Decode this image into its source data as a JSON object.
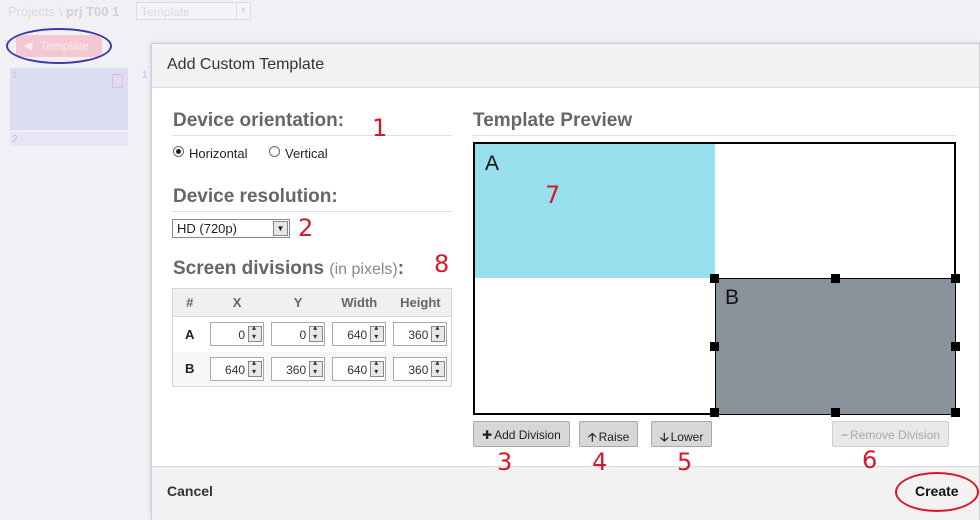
{
  "background": {
    "breadcrumb_prefix": "Projects \\",
    "breadcrumb_project": "prj T00 1",
    "select_value": "Template",
    "template_button": "Template",
    "card_numbers": [
      "1",
      "2",
      "1"
    ]
  },
  "dialog": {
    "title": "Add Custom Template",
    "orientation": {
      "title": "Device orientation:",
      "options": [
        {
          "label": "Horizontal",
          "checked": true
        },
        {
          "label": "Vertical",
          "checked": false
        }
      ]
    },
    "resolution": {
      "title": "Device resolution:",
      "selected": "HD (720p)"
    },
    "divisions": {
      "title": "Screen divisions",
      "subtitle": "(in pixels)",
      "colon": ":",
      "columns": [
        "#",
        "X",
        "Y",
        "Width",
        "Height"
      ],
      "rows": [
        {
          "id": "A",
          "x": "0",
          "y": "0",
          "width": "640",
          "height": "360"
        },
        {
          "id": "B",
          "x": "640",
          "y": "360",
          "width": "640",
          "height": "360"
        }
      ]
    },
    "preview": {
      "title": "Template Preview",
      "division_a_label": "A",
      "division_b_label": "B"
    },
    "buttons": {
      "add_division": "Add Division",
      "raise": "Raise",
      "lower": "Lower",
      "remove_division": "Remove Division",
      "cancel": "Cancel",
      "create": "Create"
    }
  },
  "annotations": [
    "1",
    "2",
    "3",
    "4",
    "5",
    "6",
    "7",
    "8"
  ],
  "colors": {
    "division_a": "#98dfee",
    "division_b": "#8a939c",
    "annotation": "#d6182a",
    "oval_blue": "#3a3aaa"
  },
  "icons": {
    "add": "plus-icon",
    "raise": "arrow-up-icon",
    "lower": "arrow-down-icon",
    "remove": "minus-icon"
  }
}
